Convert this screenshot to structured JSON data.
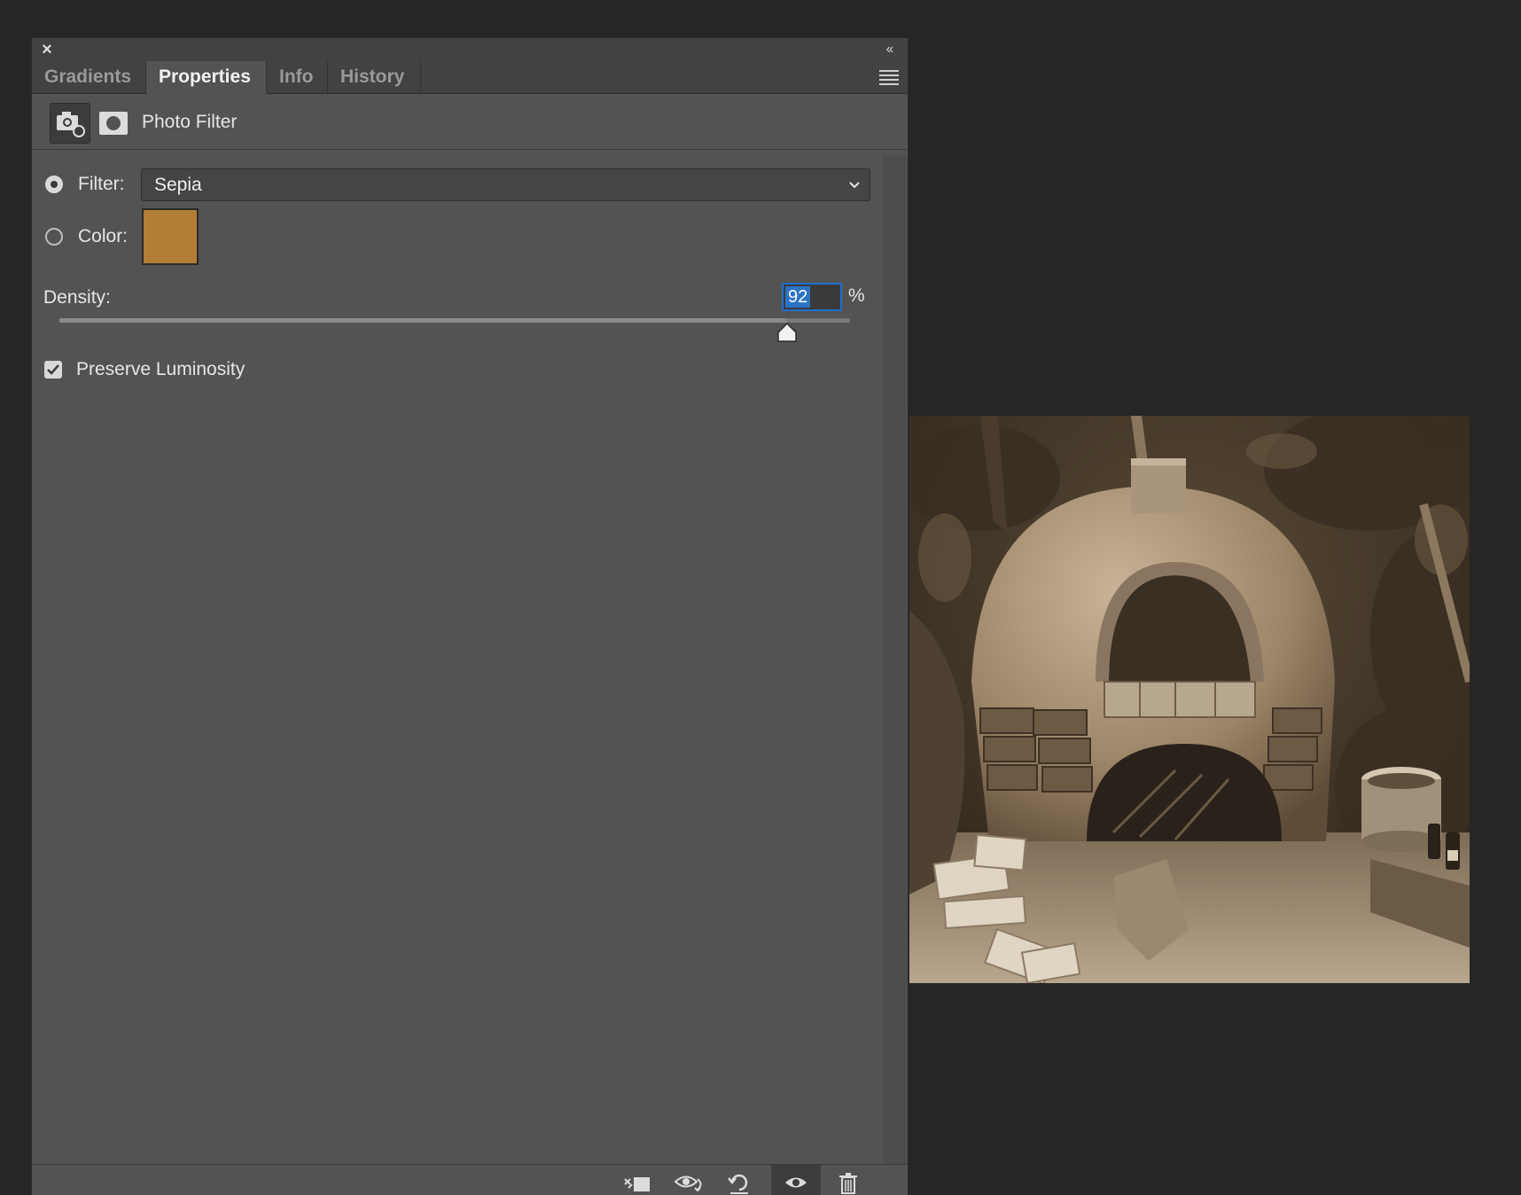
{
  "panel": {
    "tabs": [
      {
        "label": "Gradients",
        "active": false
      },
      {
        "label": "Properties",
        "active": true
      },
      {
        "label": "Info",
        "active": false
      },
      {
        "label": "History",
        "active": false
      }
    ],
    "header_title": "Photo Filter"
  },
  "filter": {
    "label": "Filter:",
    "selected": "Sepia",
    "radio_checked": true
  },
  "color": {
    "label": "Color:",
    "swatch": "#b27d36",
    "radio_checked": false
  },
  "density": {
    "label": "Density:",
    "value": "92",
    "unit": "%",
    "percent": 92
  },
  "preserve_luminosity": {
    "label": "Preserve Luminosity",
    "checked": true
  },
  "bottom_toolbar": {
    "icons": [
      "clip-to-layer-icon",
      "view-previous-state-icon",
      "reset-icon",
      "visibility-eye-icon",
      "trash-icon"
    ]
  },
  "colors": {
    "background": "#262626",
    "panel": "#535353",
    "tab_bar": "#424242",
    "accent": "#2c73c5"
  }
}
